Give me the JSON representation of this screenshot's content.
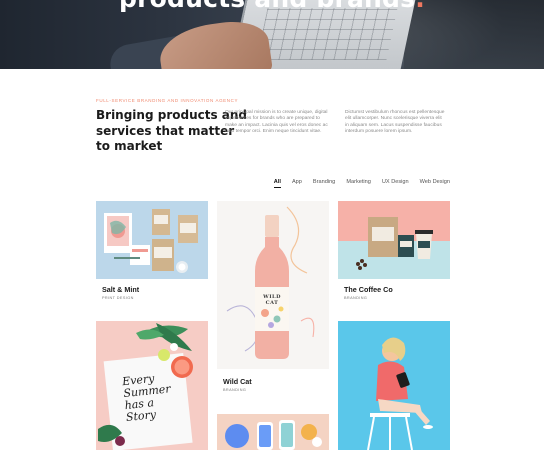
{
  "hero": {
    "title": "products and brands",
    "title_dot": ".",
    "accent_color": "#f07860"
  },
  "intro": {
    "eyebrow": "FULL-SERVICE BRANDING AND INNOVATION AGENCY",
    "headline_lines": [
      "Bringing products and",
      "services that matter",
      "to market"
    ],
    "paragraph_1_lines": [
      "Our principal mission is to create unique, digital",
      "experiences for brands who are prepared to",
      "make an impact. Lacinia quis vel eros donec ac",
      "odio tempor orci. Enim neque tincidunt vitae."
    ],
    "paragraph_2_lines": [
      "Dictumst vestibulum rhoncus est pellentesque",
      "elit ullamcorper. Nunc scelerisque viverra elit",
      "in aliquam sem. Lacus suspendisse faucibus",
      "interdum posuere lorem ipsum."
    ]
  },
  "filters": {
    "items": [
      "All",
      "App",
      "Branding",
      "Marketing",
      "UX Design",
      "Web Design"
    ],
    "active": "All"
  },
  "projects": [
    {
      "title": "Salt & Mint",
      "category": "PRINT DESIGN"
    },
    {
      "title": "The Coffee Co",
      "category": "BRANDING"
    },
    {
      "title": "Wild Cat",
      "category": "BRANDING"
    },
    {
      "title": "",
      "category": ""
    },
    {
      "title": "",
      "category": ""
    },
    {
      "title": "",
      "category": ""
    }
  ],
  "artwork": {
    "wine_label": "WILD CAT",
    "poster_text": [
      "Every",
      "Summer",
      "has a",
      "Story"
    ],
    "salt_mint_label": "SALT & MINT"
  }
}
